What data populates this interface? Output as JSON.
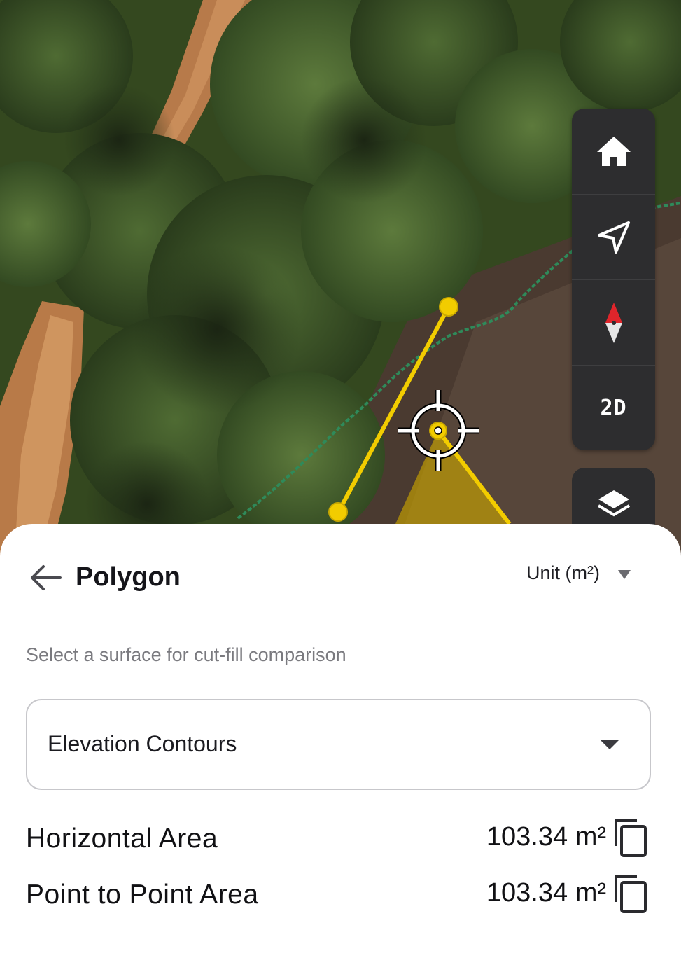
{
  "map": {
    "controls": [
      {
        "name": "home",
        "icon": "home-icon"
      },
      {
        "name": "locate",
        "icon": "navigation-arrow-icon"
      },
      {
        "name": "compass",
        "icon": "compass-icon"
      },
      {
        "name": "view-mode",
        "label": "2D"
      }
    ],
    "layers_icon": "layers-icon",
    "measure_color": "#f2cc00"
  },
  "panel": {
    "title": "Polygon",
    "unit_label": "Unit (m²)",
    "hint": "Select a surface for cut-fill comparison",
    "surface_value": "Elevation Contours",
    "metrics": [
      {
        "label": "Horizontal Area",
        "value": "103.34 m²"
      },
      {
        "label": "Point to Point Area",
        "value": "103.34 m²"
      }
    ]
  }
}
